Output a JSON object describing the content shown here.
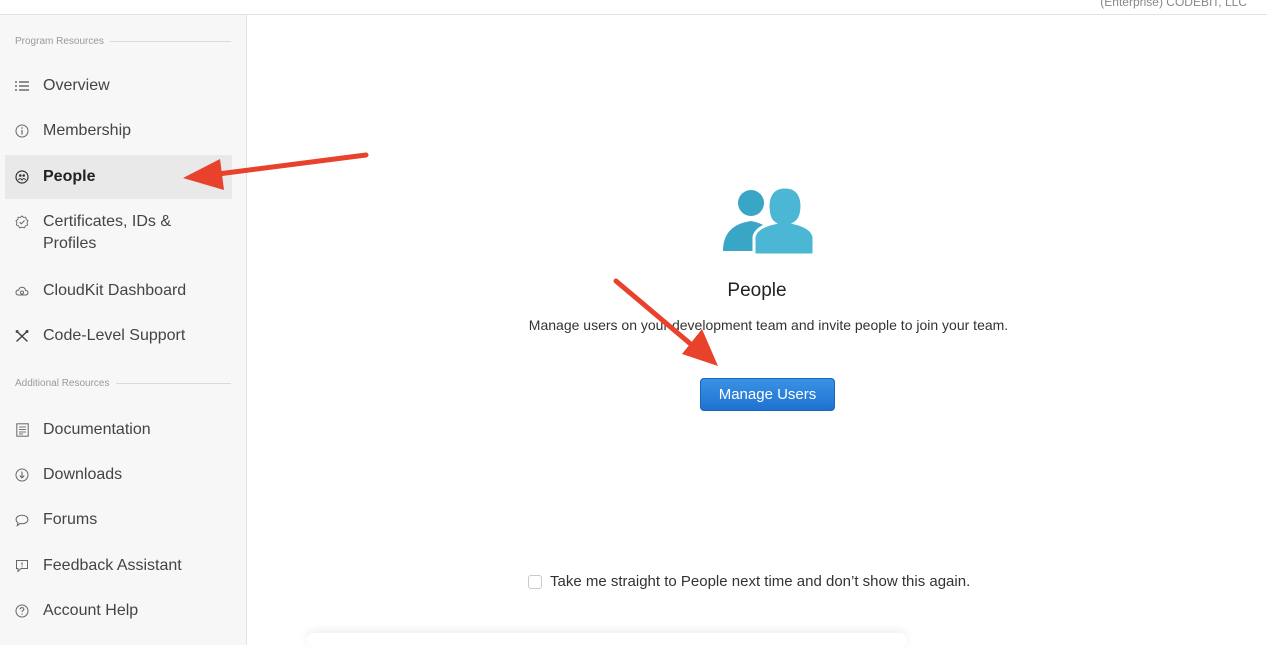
{
  "topbar": {
    "team_text": "(Enterprise) CODEBIT, LLC"
  },
  "sidebar": {
    "program_heading": "Program Resources",
    "additional_heading": "Additional Resources",
    "program_items": [
      {
        "label": "Overview",
        "icon": "list-icon"
      },
      {
        "label": "Membership",
        "icon": "info-icon"
      },
      {
        "label": "People",
        "icon": "people-icon",
        "active": true
      },
      {
        "label": "Certificates, IDs &",
        "label2": "Profiles",
        "icon": "badge-check-icon"
      },
      {
        "label": "CloudKit Dashboard",
        "icon": "cloud-icon"
      },
      {
        "label": "Code-Level Support",
        "icon": "tools-icon"
      }
    ],
    "additional_items": [
      {
        "label": "Documentation",
        "icon": "document-icon"
      },
      {
        "label": "Downloads",
        "icon": "download-icon"
      },
      {
        "label": "Forums",
        "icon": "speech-bubble-icon"
      },
      {
        "label": "Feedback Assistant",
        "icon": "feedback-icon"
      },
      {
        "label": "Account Help",
        "icon": "question-icon"
      }
    ]
  },
  "main": {
    "title": "People",
    "description": "Manage users on your development team and invite people to join your team.",
    "button_label": "Manage Users",
    "checkbox_label": "Take me straight to People next time and don’t show this again.",
    "checkbox_checked": false
  },
  "colors": {
    "accent": "#1f73d0",
    "people_icon": "#3aa6c6",
    "annotation_arrow": "#e8412c"
  }
}
